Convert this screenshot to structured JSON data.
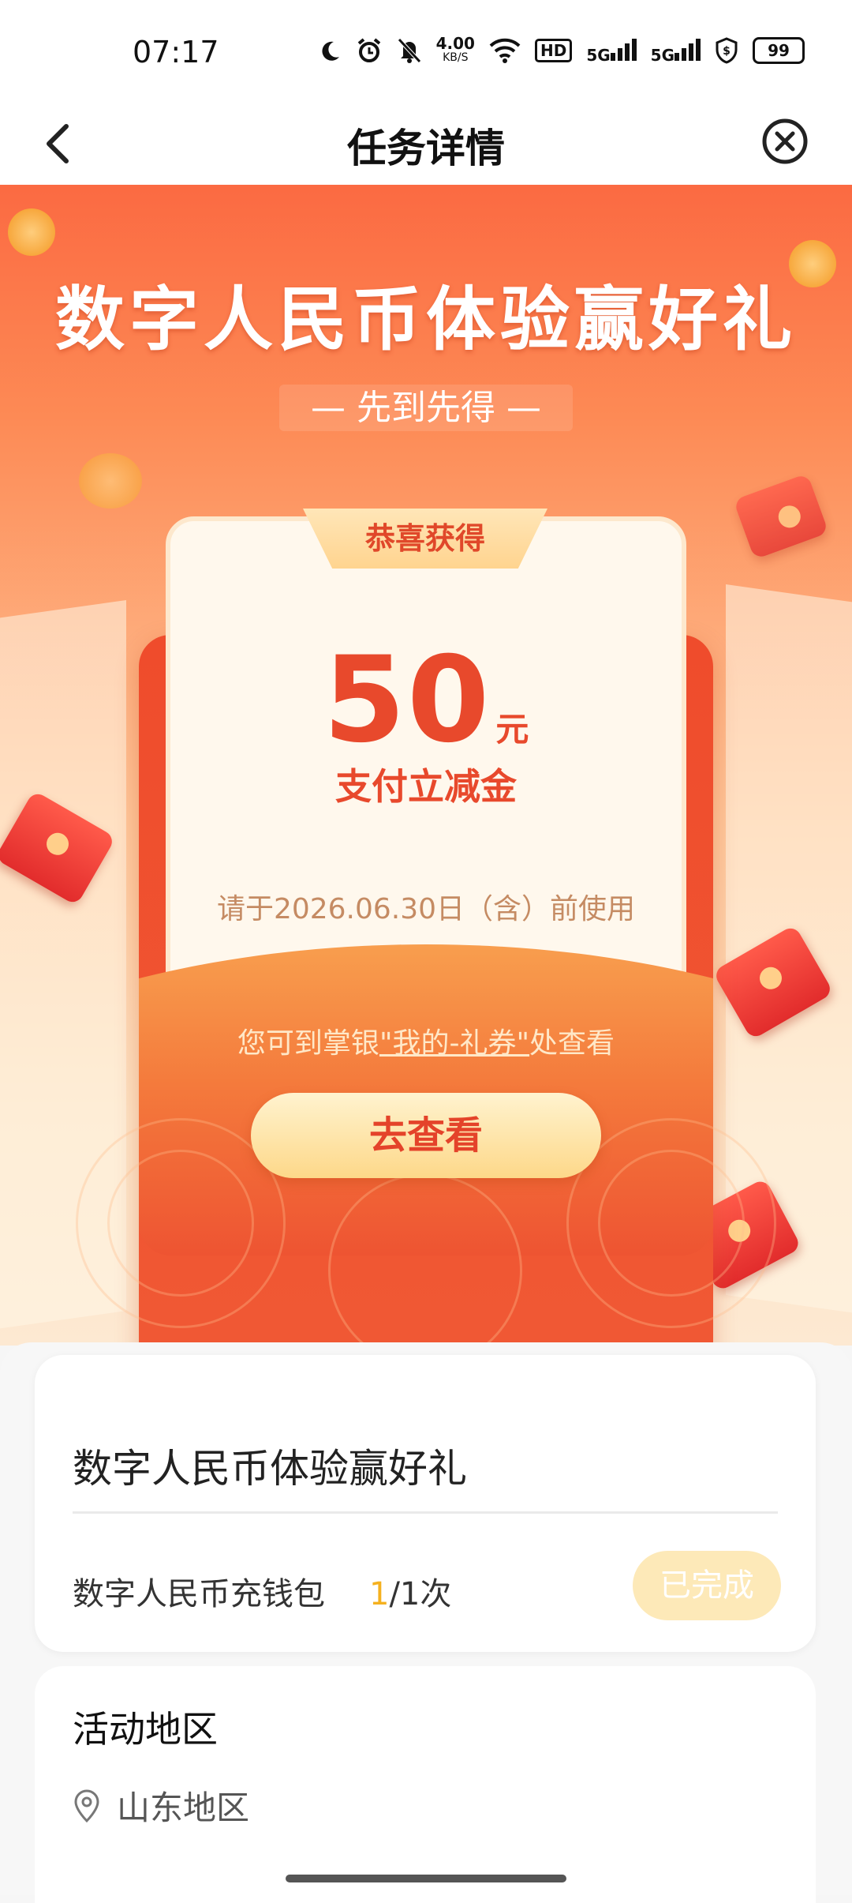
{
  "status_bar": {
    "time": "07:17",
    "net_speed": "4.00",
    "net_speed_unit": "KB/S",
    "hd_label": "HD",
    "network_1": "5G",
    "network_2": "5G",
    "battery": "99",
    "icons": [
      "moon-icon",
      "alarm-icon",
      "mute-bell-icon",
      "wifi-icon",
      "hd-icon",
      "signal-icon",
      "signal-icon",
      "shield-dollar-icon",
      "battery-icon"
    ]
  },
  "nav": {
    "title": "任务详情",
    "back_icon": "chevron-left-icon",
    "close_icon": "close-circle-icon"
  },
  "hero": {
    "title": "数字人民币体验赢好礼",
    "subtitle": "— 先到先得 —",
    "card_tab": "恭喜获得",
    "amount": "50",
    "amount_unit": "元",
    "coupon_type": "支付立减金",
    "expiry": "请于2026.06.30日（含）前使用",
    "hint_prefix": "您可到掌银",
    "hint_link": "\"我的-礼券\"",
    "hint_suffix": "处查看",
    "button": "去查看"
  },
  "task": {
    "title": "数字人民币体验赢好礼",
    "item_label": "数字人民币充钱包",
    "progress_done": "1",
    "progress_rest": "/1次",
    "status": "已完成"
  },
  "region": {
    "heading": "活动地区",
    "value": "山东地区",
    "icon": "location-pin-icon"
  },
  "colors": {
    "hero_top": "#fb6a42",
    "accent_red": "#e8492c",
    "progress_yellow": "#f5b11f",
    "status_bg": "#fde9b8"
  }
}
